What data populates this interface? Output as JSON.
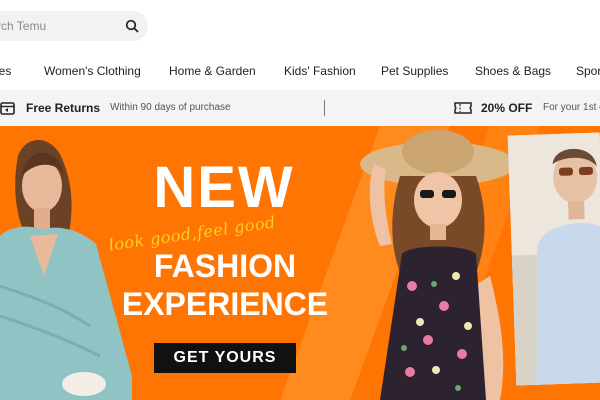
{
  "search": {
    "placeholder": "rch Temu"
  },
  "categories": [
    "ies",
    "Women's Clothing",
    "Home & Garden",
    "Kids' Fashion",
    "Pet Supplies",
    "Shoes & Bags",
    "Spor"
  ],
  "promo": {
    "left_title": "Free Returns",
    "left_sub": "Within 90 days of purchase",
    "right_title": "20% OFF",
    "right_sub": "For your 1st o"
  },
  "banner": {
    "headline": "NEW",
    "tagline": "look good,feel good",
    "line2": "FASHION",
    "line3": "EXPERIENCE",
    "cta": "GET YOURS"
  },
  "colors": {
    "banner": "#fe7504",
    "accent": "#ffcf22",
    "cta": "#111111"
  }
}
